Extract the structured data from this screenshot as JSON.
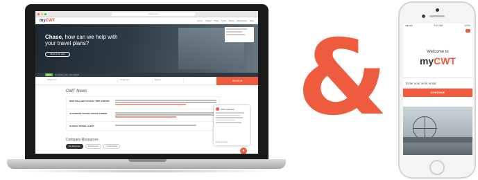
{
  "laptop": {
    "url": "mycwt.com",
    "brand_prefix": "my",
    "brand_suffix": "CWT",
    "nav_links": [
      "Home",
      "Travel",
      "Trips",
      "Tools",
      "News",
      "Resources",
      "Help"
    ],
    "hero": {
      "title_bold": "Chase,",
      "title_rest": "how can we help with your travel plans?",
      "button": "Book a trip now"
    },
    "alert": {
      "tag": "NEW",
      "text": "Company alert information"
    },
    "search": {
      "fields": [
        "Where to?",
        "Departure",
        "Return"
      ],
      "button": "SEARCH"
    },
    "news": {
      "title": "CWT News",
      "items": [
        {
          "title": "NEW HOLLAND HOLIDAY TRIP EUROPE"
        },
        {
          "title": "ALTERNATE TRAVEL OFFICE FINDER"
        },
        {
          "title": "GLOBAL TRAVEL ALERT"
        }
      ]
    },
    "resources": {
      "title": "Company Resources",
      "tabs": [
        "Top Resources",
        "All Resources",
        "Travel Policies"
      ]
    },
    "chat": {
      "agent": "CWT Assistant",
      "input": "Write a reply..."
    },
    "chat_fab_icon": "chat-icon"
  },
  "ampersand": "&",
  "phone": {
    "time": "9:41 AM",
    "carrier": "●●●●●",
    "battery": "100%",
    "welcome": "Welcome to",
    "brand_prefix": "my",
    "brand_suffix": "CWT",
    "email_placeholder": "Enter your work email",
    "continue": "CONTINUE"
  },
  "colors": {
    "accent": "#ef5b3f",
    "dark": "#1a1a1a"
  }
}
